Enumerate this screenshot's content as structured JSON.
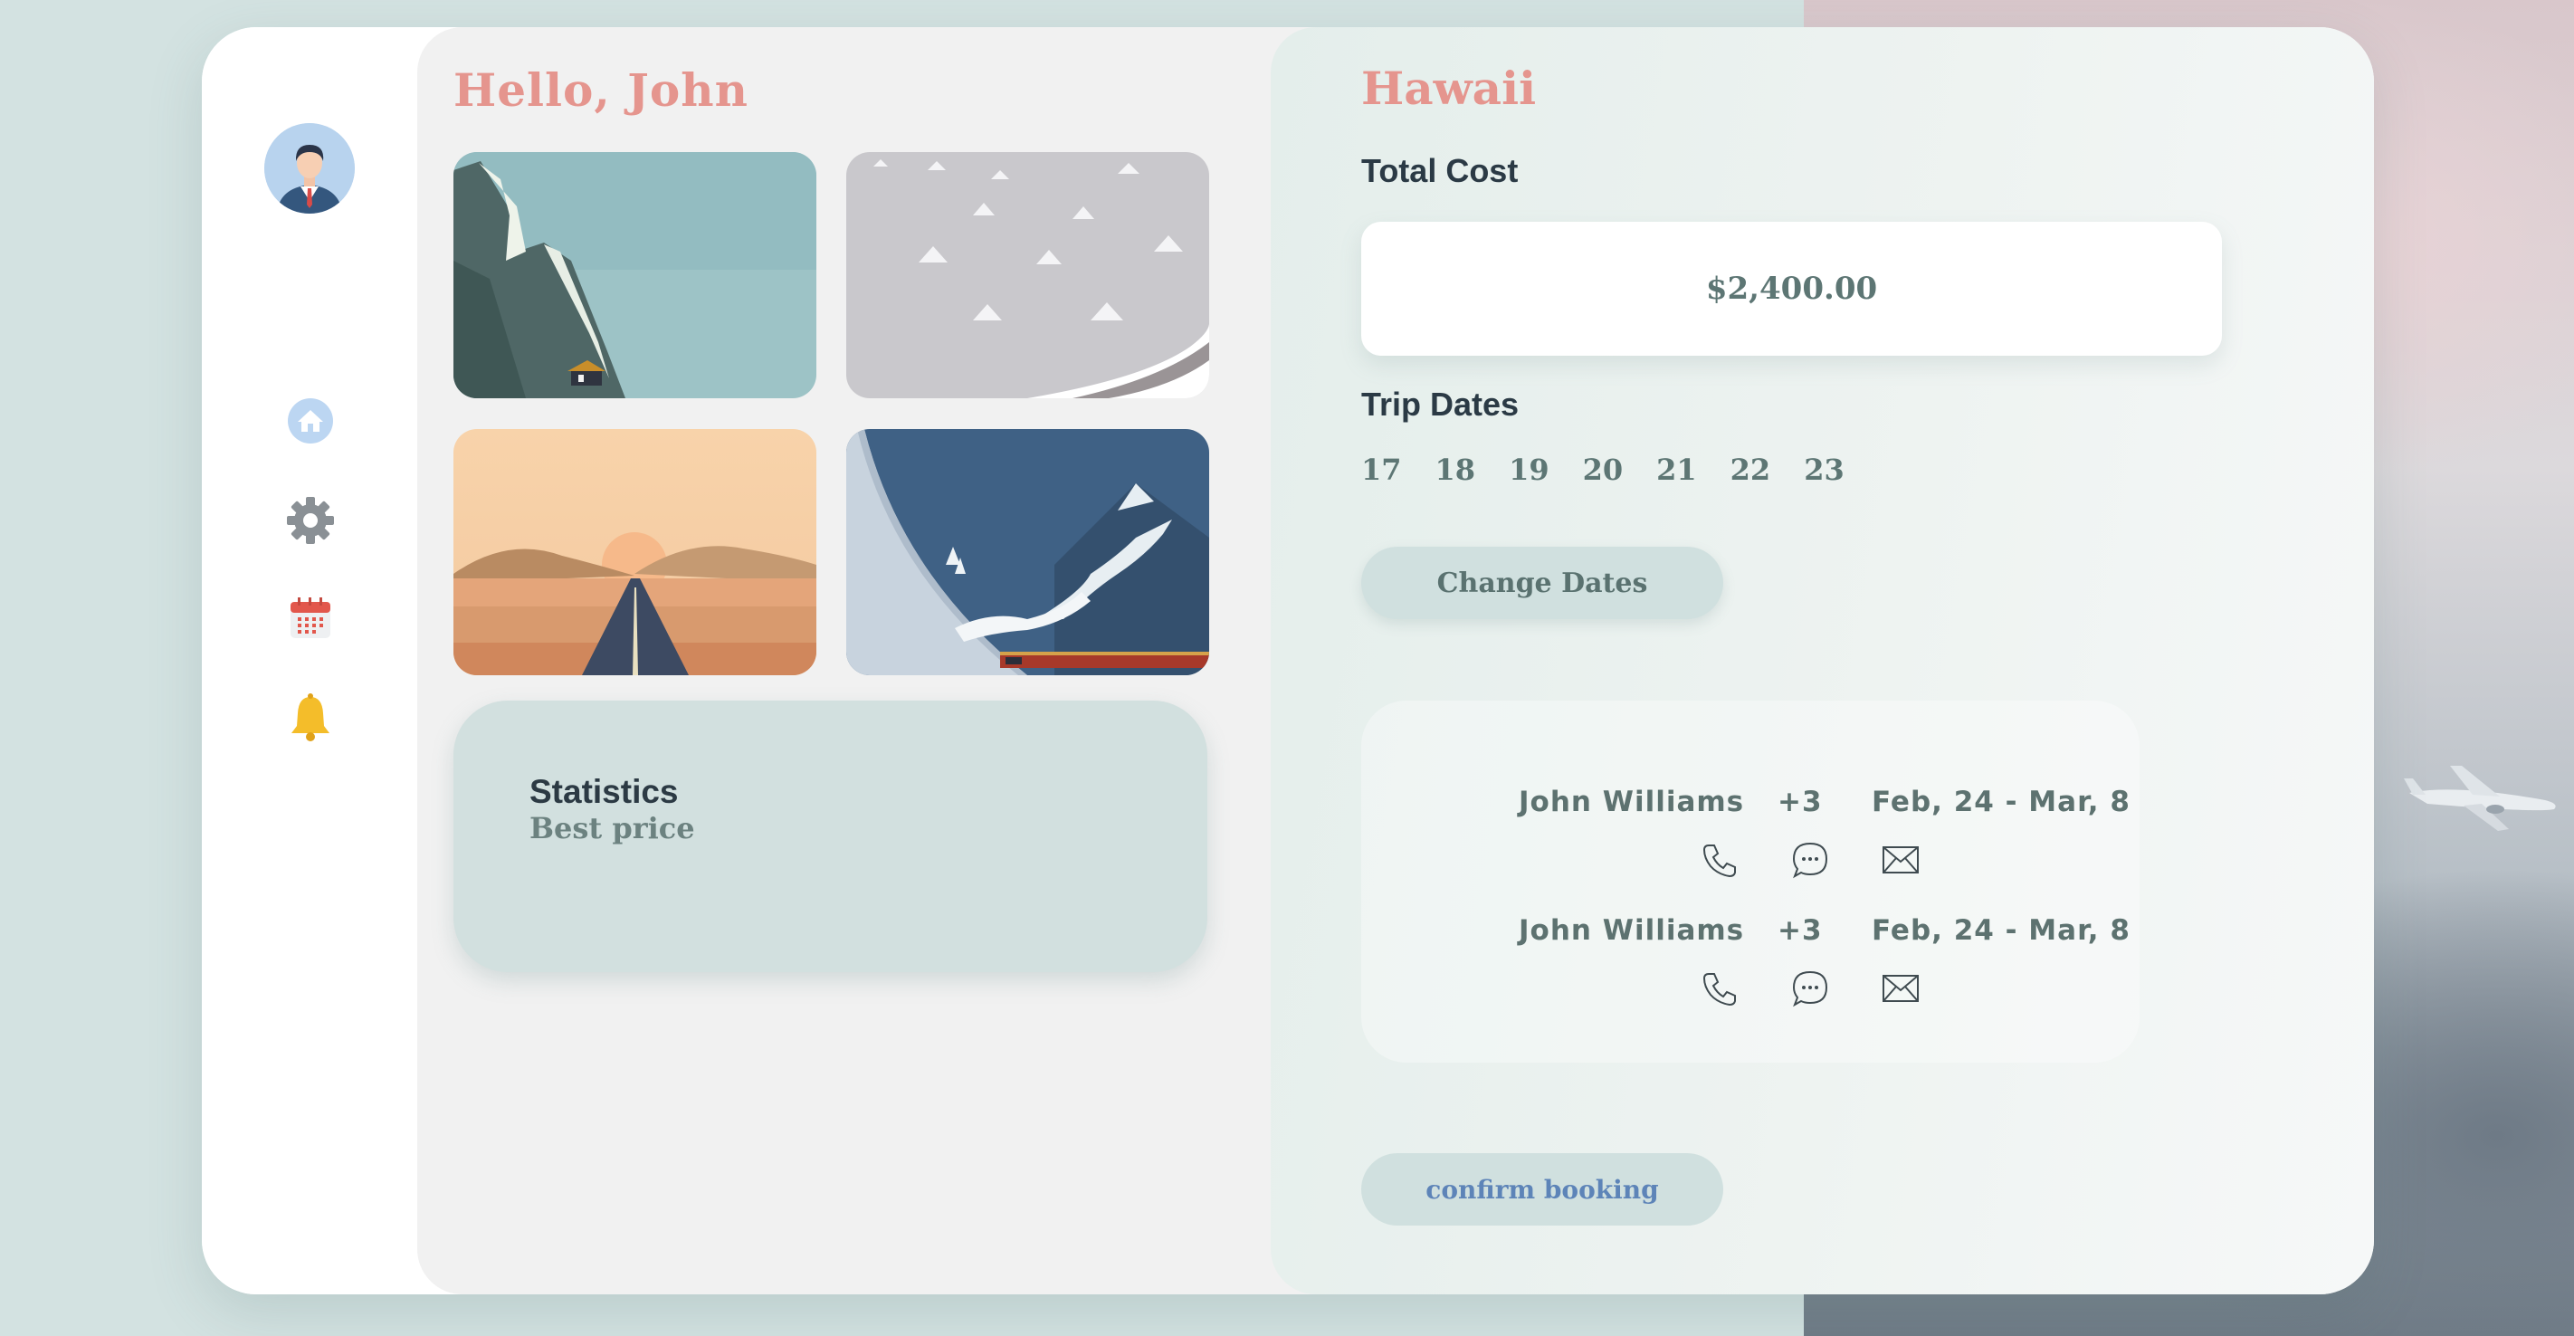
{
  "greeting": "Hello, John",
  "sidebar": {
    "items": [
      {
        "name": "home",
        "icon": "home-icon"
      },
      {
        "name": "settings",
        "icon": "gear-icon"
      },
      {
        "name": "calendar",
        "icon": "calendar-icon"
      },
      {
        "name": "notifications",
        "icon": "bell-icon"
      }
    ]
  },
  "gallery": [
    "cliff",
    "snow-slope",
    "desert-road",
    "mountain-train"
  ],
  "statistics": {
    "title": "Statistics",
    "subtitle": "Best price"
  },
  "trip": {
    "destination": "Hawaii",
    "total_cost_label": "Total Cost",
    "total_cost": "$2,400.00",
    "dates_label": "Trip Dates",
    "dates": [
      "17",
      "18",
      "19",
      "20",
      "21",
      "22",
      "23"
    ],
    "change_dates_label": "Change Dates",
    "confirm_label": "confirm booking"
  },
  "contacts": [
    {
      "name": "John Williams",
      "extra": "+3",
      "range": "Feb, 24 - Mar, 8"
    },
    {
      "name": "John Williams",
      "extra": "+3",
      "range": "Feb, 24 - Mar, 8"
    }
  ],
  "colors": {
    "accent": "#e5958e",
    "primary_text": "#2b3a45",
    "muted_text": "#5d7674",
    "panel": "#d2e0df",
    "link": "#5d84b8"
  }
}
